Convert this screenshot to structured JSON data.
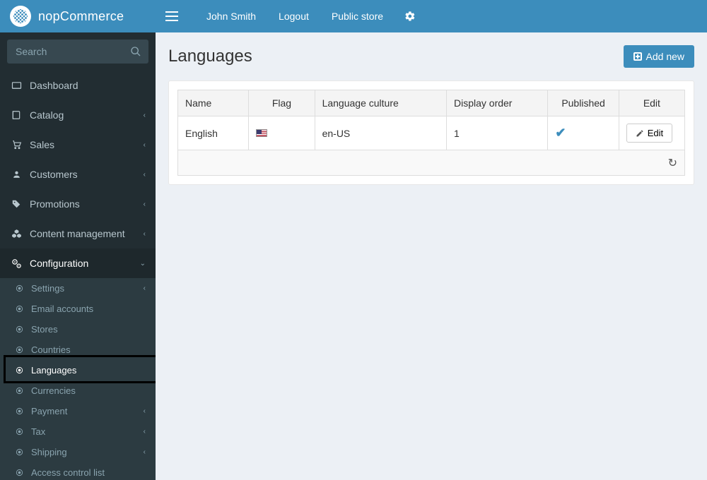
{
  "brand": "nopCommerce",
  "header": {
    "user": "John Smith",
    "logout": "Logout",
    "public_store": "Public store"
  },
  "search": {
    "placeholder": "Search"
  },
  "sidebar": {
    "items": [
      {
        "label": "Dashboard"
      },
      {
        "label": "Catalog"
      },
      {
        "label": "Sales"
      },
      {
        "label": "Customers"
      },
      {
        "label": "Promotions"
      },
      {
        "label": "Content management"
      },
      {
        "label": "Configuration"
      }
    ],
    "config_children": [
      {
        "label": "Settings",
        "has_children": true
      },
      {
        "label": "Email accounts",
        "has_children": false
      },
      {
        "label": "Stores",
        "has_children": false
      },
      {
        "label": "Countries",
        "has_children": false
      },
      {
        "label": "Languages",
        "has_children": false,
        "active": true
      },
      {
        "label": "Currencies",
        "has_children": false
      },
      {
        "label": "Payment",
        "has_children": true
      },
      {
        "label": "Tax",
        "has_children": true
      },
      {
        "label": "Shipping",
        "has_children": true
      },
      {
        "label": "Access control list",
        "has_children": false
      }
    ]
  },
  "page": {
    "title": "Languages",
    "add_new": "Add new"
  },
  "table": {
    "columns": {
      "name": "Name",
      "flag": "Flag",
      "culture": "Language culture",
      "display_order": "Display order",
      "published": "Published",
      "edit": "Edit"
    },
    "rows": [
      {
        "name": "English",
        "culture": "en-US",
        "display_order": "1",
        "published": true,
        "edit_label": "Edit"
      }
    ]
  }
}
